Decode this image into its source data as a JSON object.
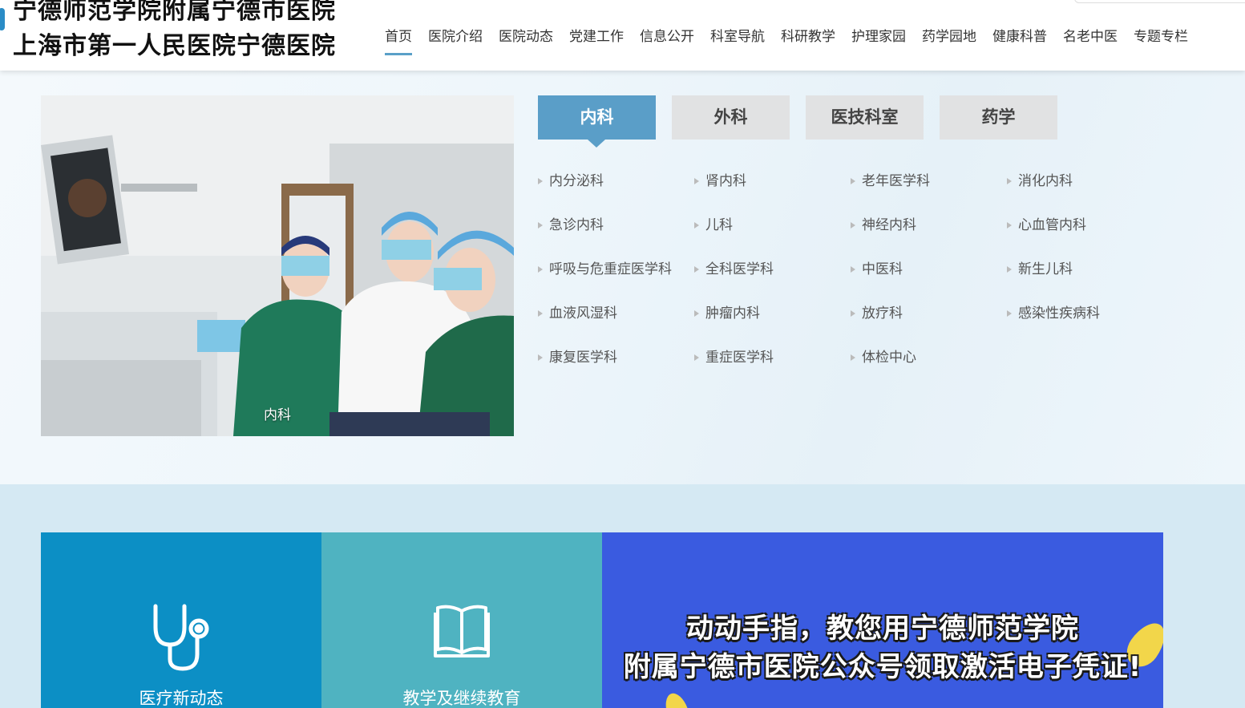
{
  "header": {
    "title_line1": "宁德师范学院附属宁德市医院",
    "title_line2": "上海市第一人民医院宁德医院",
    "nav": [
      "首页",
      "医院介绍",
      "医院动态",
      "党建工作",
      "信息公开",
      "科室导航",
      "科研教学",
      "护理家园",
      "药学园地",
      "健康科普",
      "名老中医",
      "专题专栏"
    ],
    "active_nav": "首页"
  },
  "departments": {
    "photo_caption": "内科",
    "tabs": [
      "内科",
      "外科",
      "医技科室",
      "药学"
    ],
    "active_tab": "内科",
    "items": [
      "内分泌科",
      "肾内科",
      "老年医学科",
      "消化内科",
      "急诊内科",
      "儿科",
      "神经内科",
      "心血管内科",
      "呼吸与危重症医学科",
      "全科医学科",
      "中医科",
      "新生儿科",
      "血液风湿科",
      "肿瘤内科",
      "放疗科",
      "感染性疾病科",
      "康复医学科",
      "重症医学科",
      "体检中心"
    ]
  },
  "cards": [
    {
      "label": "医疗新动态",
      "icon": "stethoscope-icon"
    },
    {
      "label": "教学及继续教育",
      "icon": "book-icon"
    }
  ],
  "banner": {
    "line1": "动动手指，教您用宁德师范学院",
    "line2": "附属宁德市医院公众号领取激活电子凭证!"
  },
  "colors": {
    "accent": "#5a9ec8",
    "card1": "#0c8fc5",
    "card2": "#4fb3c1",
    "banner": "#3a5be0"
  }
}
